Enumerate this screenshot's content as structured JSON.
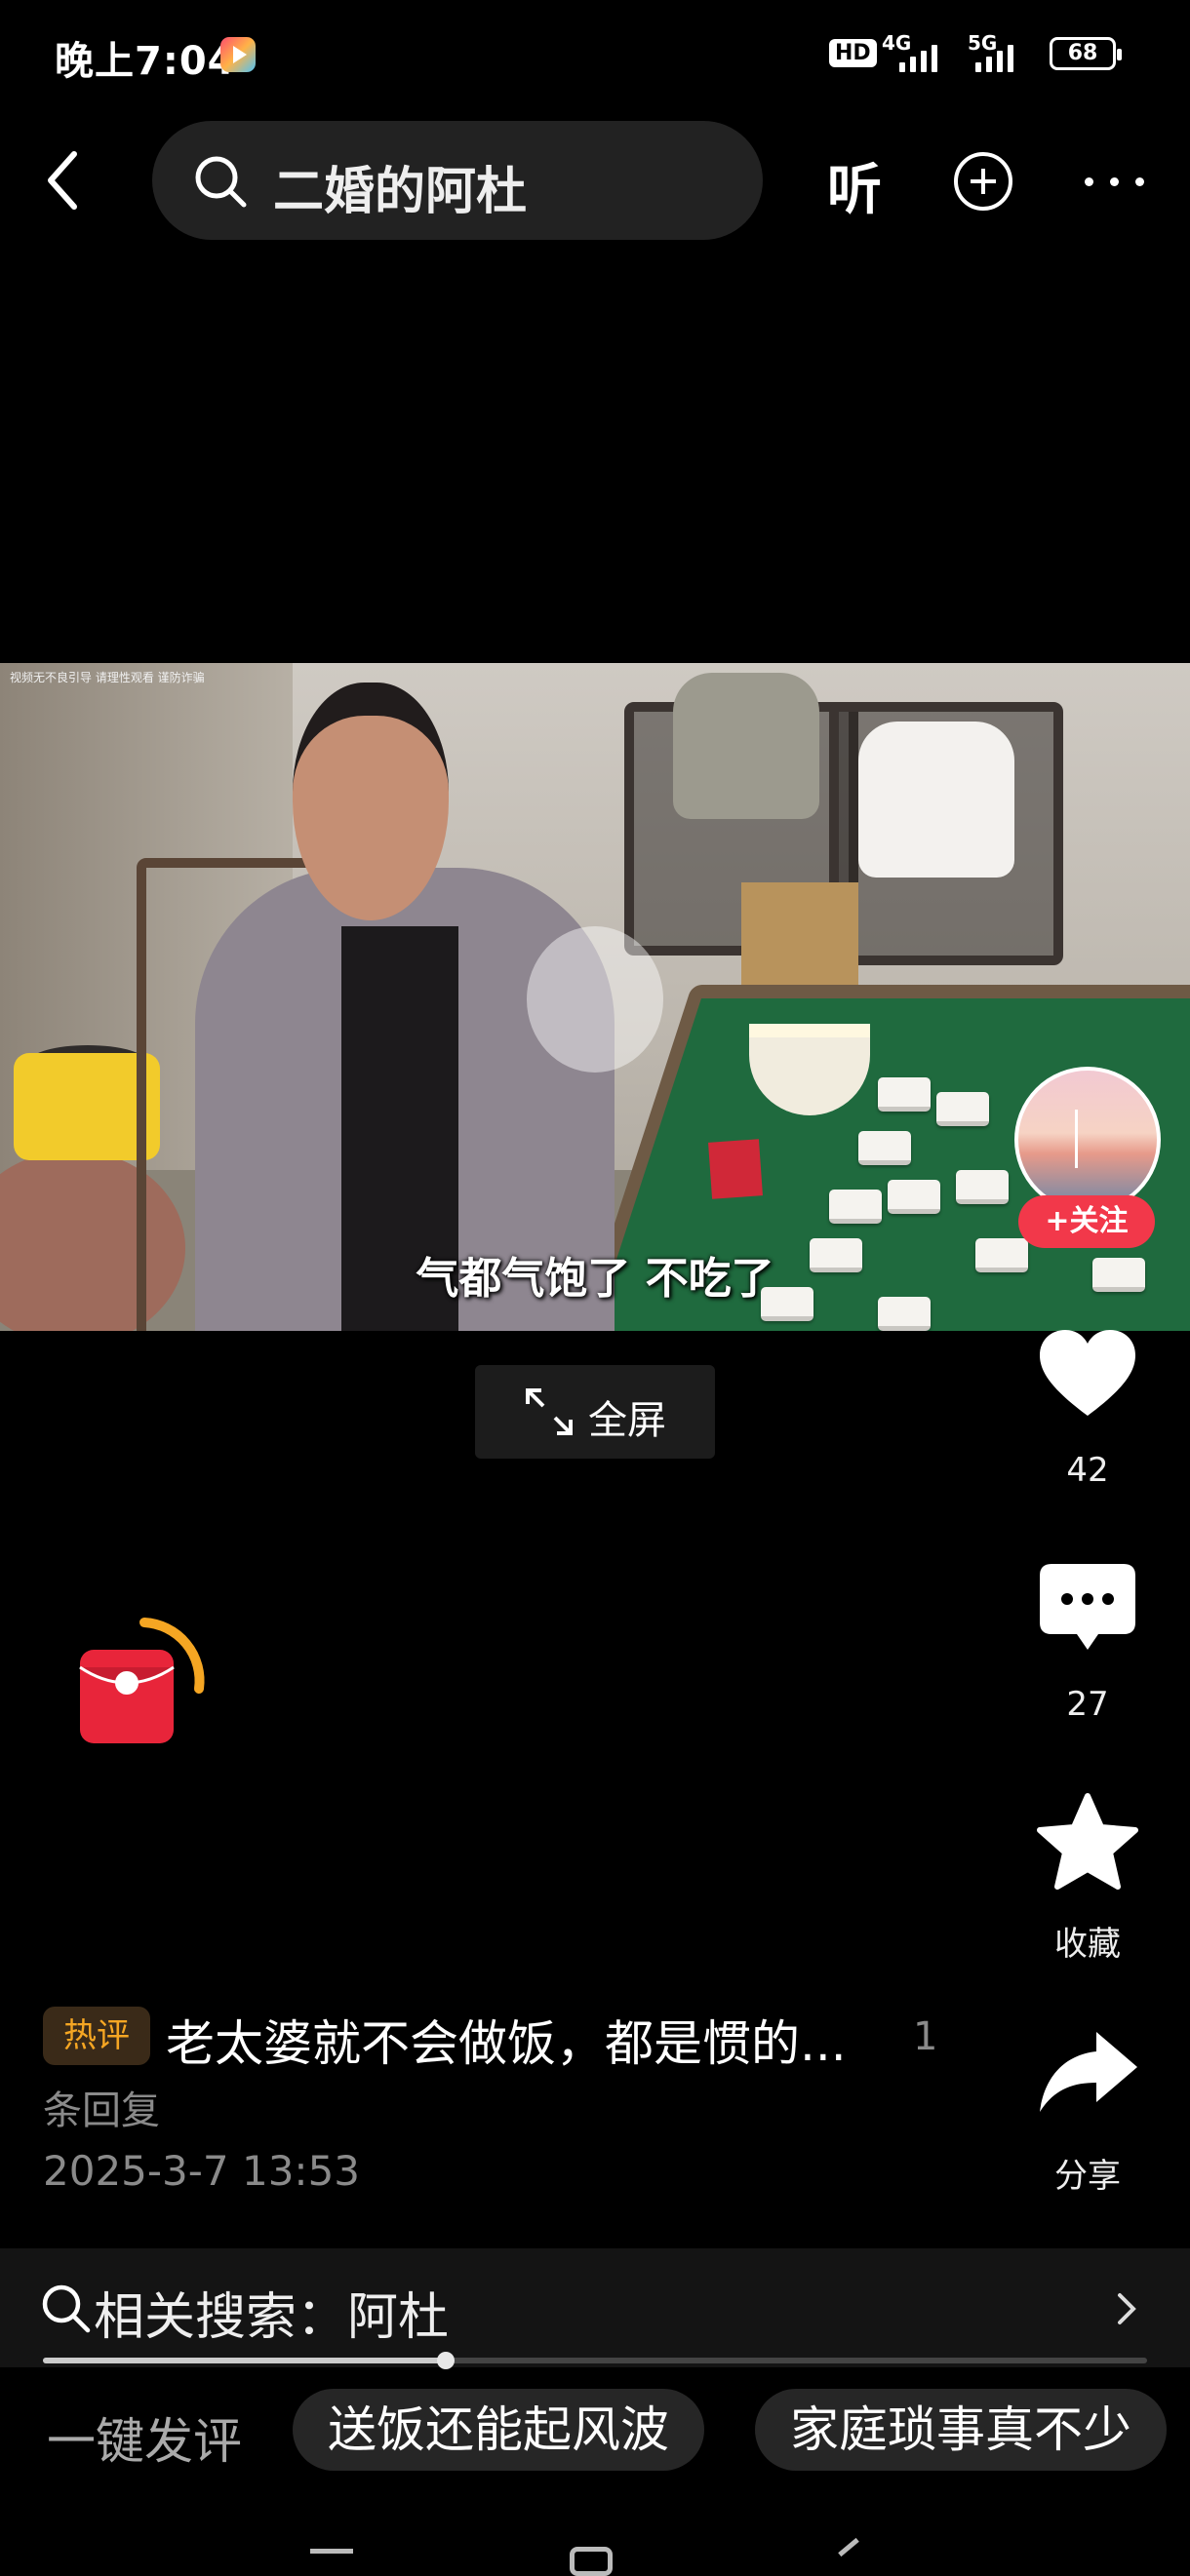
{
  "status_bar": {
    "time": "晚上7:04",
    "hd": "HD",
    "network_1": "4G",
    "network_2": "5G",
    "battery": "68"
  },
  "top_bar": {
    "search_query": "二婚的阿杜",
    "listen_label": "听"
  },
  "video": {
    "caption": "气都气饱了 不吃了",
    "watermark": "视频无不良引导 请理性观看 谨防诈骗",
    "fullscreen_label": "全屏"
  },
  "side_actions": {
    "follow_label": "+关注",
    "like_count": "42",
    "comment_count": "27",
    "favorite_label": "收藏",
    "share_label": "分享"
  },
  "hot_comment": {
    "badge": "热评",
    "text": "老太婆就不会做饭，都是惯的...",
    "reply_count": "1",
    "reply_label": "条回复",
    "timestamp": "2025-3-7 13:53"
  },
  "related_search": {
    "label": "相关搜索：阿杜"
  },
  "progress": {
    "fraction": 0.365
  },
  "quick_comment": {
    "label": "一键发评",
    "chips": [
      "送饭还能起风波",
      "家庭琐事真不少"
    ]
  },
  "colors": {
    "follow_red": "#f2384a",
    "hot_badge_text": "#f5a623",
    "redpacket_red": "#e8253a",
    "redpacket_ring": "#f5a623"
  }
}
